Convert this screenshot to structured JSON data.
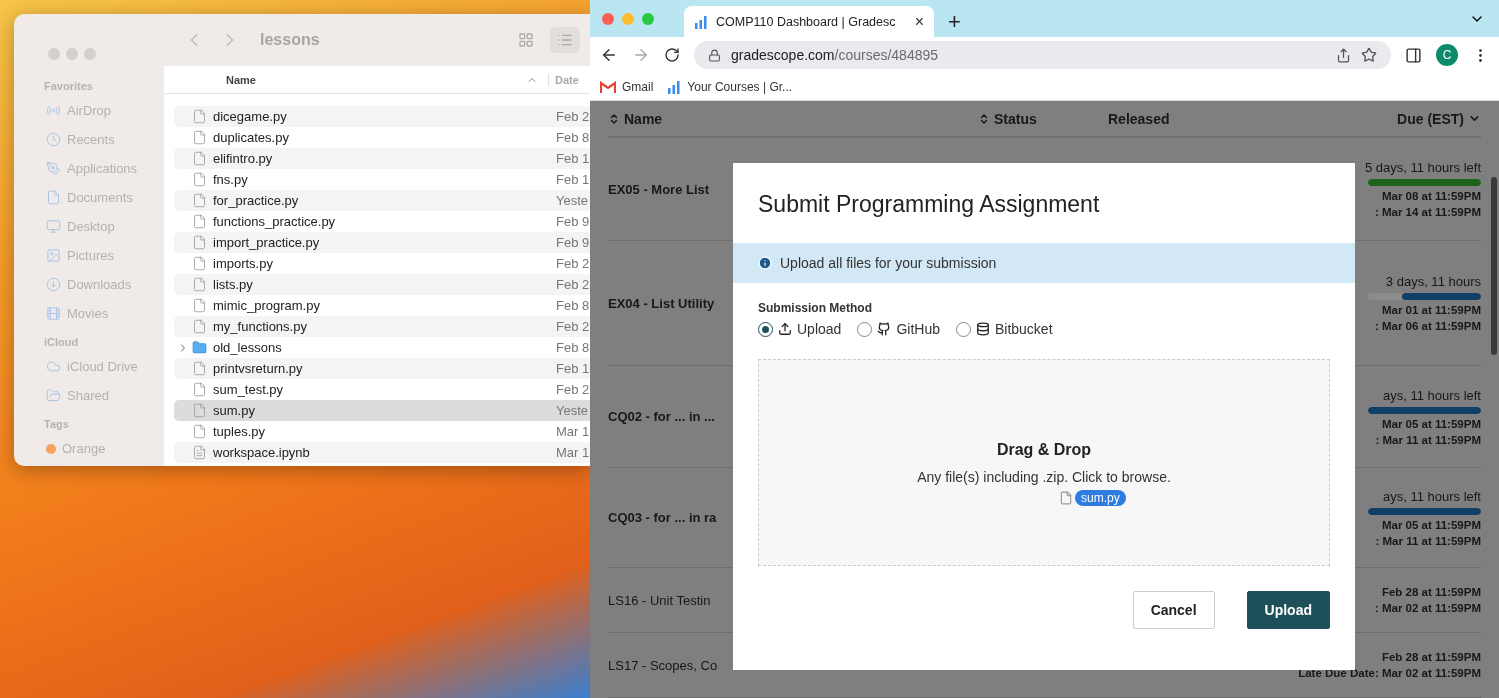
{
  "finder": {
    "title": "lessons",
    "sidebar": [
      {
        "heading": "Favorites",
        "items": [
          {
            "label": "AirDrop"
          },
          {
            "label": "Recents"
          },
          {
            "label": "Applications"
          },
          {
            "label": "Documents"
          },
          {
            "label": "Desktop"
          },
          {
            "label": "Pictures"
          },
          {
            "label": "Downloads"
          },
          {
            "label": "Movies"
          }
        ]
      },
      {
        "heading": "iCloud",
        "items": [
          {
            "label": "iCloud Drive"
          },
          {
            "label": "Shared"
          }
        ]
      },
      {
        "heading": "Tags",
        "items": [
          {
            "label": "Orange",
            "color": "#f5a35c"
          }
        ]
      }
    ],
    "columns": [
      "Name",
      "Date"
    ],
    "files": [
      {
        "name": "dicegame.py",
        "date": "Feb 2",
        "kind": "file",
        "selected": false
      },
      {
        "name": "duplicates.py",
        "date": "Feb 8",
        "kind": "file",
        "selected": false
      },
      {
        "name": "elifintro.py",
        "date": "Feb 1",
        "kind": "file",
        "selected": false
      },
      {
        "name": "fns.py",
        "date": "Feb 1",
        "kind": "file",
        "selected": false
      },
      {
        "name": "for_practice.py",
        "date": "Yeste",
        "kind": "file",
        "selected": false
      },
      {
        "name": "functions_practice.py",
        "date": "Feb 9",
        "kind": "file",
        "selected": false
      },
      {
        "name": "import_practice.py",
        "date": "Feb 9",
        "kind": "file",
        "selected": false
      },
      {
        "name": "imports.py",
        "date": "Feb 2",
        "kind": "file",
        "selected": false
      },
      {
        "name": "lists.py",
        "date": "Feb 2",
        "kind": "file",
        "selected": false
      },
      {
        "name": "mimic_program.py",
        "date": "Feb 8",
        "kind": "file",
        "selected": false
      },
      {
        "name": "my_functions.py",
        "date": "Feb 2",
        "kind": "file",
        "selected": false
      },
      {
        "name": "old_lessons",
        "date": "Feb 8",
        "kind": "folder",
        "selected": false
      },
      {
        "name": "printvsreturn.py",
        "date": "Feb 1",
        "kind": "file",
        "selected": false
      },
      {
        "name": "sum_test.py",
        "date": "Feb 2",
        "kind": "file",
        "selected": false
      },
      {
        "name": "sum.py",
        "date": "Yeste",
        "kind": "file",
        "selected": true
      },
      {
        "name": "tuples.py",
        "date": "Mar 1",
        "kind": "file",
        "selected": false
      },
      {
        "name": "workspace.ipynb",
        "date": "Mar 1",
        "kind": "notebook",
        "selected": false
      }
    ]
  },
  "browser": {
    "tab": {
      "title": "COMP110 Dashboard | Gradesc",
      "close": "×"
    },
    "new_tab": "+",
    "address": {
      "host": "gradescope.com",
      "path": "/courses/484895"
    },
    "avatar": "C",
    "bookmarks": [
      {
        "label": "Gmail",
        "kind": "gmail"
      },
      {
        "label": "Your Courses | Gr...",
        "kind": "gradescope"
      }
    ]
  },
  "table": {
    "columns": [
      "Name",
      "Status",
      "Released",
      "Due (EST)"
    ],
    "rows": [
      {
        "name": "EX05 - More List",
        "bold": true,
        "time_left": "5 days, 11 hours left",
        "bar": {
          "level": 1,
          "color": "#1c641c"
        },
        "lines": [
          "Mar 08 at 11:59PM",
          ": Mar 14 at 11:59PM"
        ]
      },
      {
        "name": "EX04 - List Utility",
        "bold": true,
        "time_left": "3 days, 11 hours",
        "bar": {
          "level": 0.7,
          "color": "#123f66"
        },
        "lines": [
          "Mar 01 at 11:59PM",
          ": Mar 06 at 11:59PM"
        ]
      },
      {
        "name": "CQ02 - for ... in ...",
        "bold": true,
        "time_left": "ays, 11 hours left",
        "bar": {
          "level": 1,
          "color": "#123f66"
        },
        "lines": [
          "Mar 05 at 11:59PM",
          ": Mar 11 at 11:59PM"
        ]
      },
      {
        "name": "CQ03 - for ... in ra",
        "bold": true,
        "time_left": "ays, 11 hours left",
        "bar": {
          "level": 1,
          "color": "#123f66"
        },
        "lines": [
          "Mar 05 at 11:59PM",
          ": Mar 11 at 11:59PM"
        ]
      },
      {
        "name": "LS16 - Unit Testin",
        "bold": false,
        "lines": [
          "Feb 28 at 11:59PM",
          ": Mar 02 at 11:59PM"
        ]
      },
      {
        "name": "LS17 - Scopes, Co",
        "bold": false,
        "lines": [
          "Feb 28 at 11:59PM",
          "Late Due Date: Mar 02 at 11:59PM"
        ]
      }
    ]
  },
  "modal": {
    "title": "Submit Programming Assignment",
    "notice": "Upload all files for your submission",
    "method_label": "Submission Method",
    "methods": [
      {
        "label": "Upload",
        "kind": "upload",
        "selected": true
      },
      {
        "label": "GitHub",
        "kind": "github",
        "selected": false
      },
      {
        "label": "Bitbucket",
        "kind": "bitbucket",
        "selected": false
      }
    ],
    "drop_title": "Drag & Drop",
    "drop_hint": "Any file(s) including .zip. Click to browse.",
    "dragged_file": "sum.py",
    "buttons": [
      {
        "label": "Cancel",
        "kind": "secondary"
      },
      {
        "label": "Upload",
        "kind": "primary"
      }
    ]
  }
}
